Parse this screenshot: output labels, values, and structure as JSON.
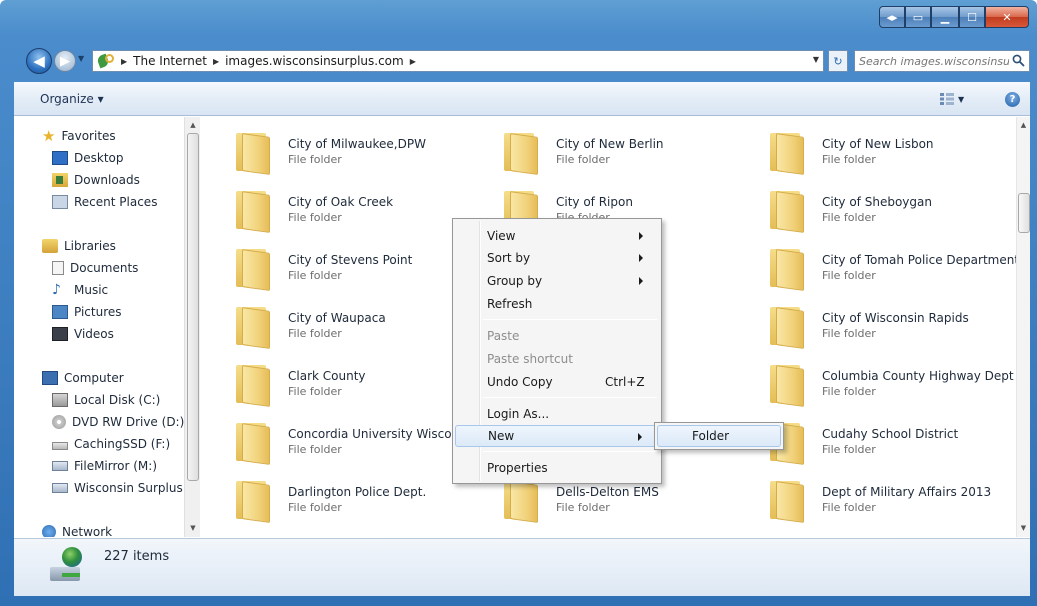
{
  "address": {
    "crumbs": [
      "The Internet",
      "images.wisconsinsurplus.com"
    ]
  },
  "search": {
    "placeholder": "Search images.wisconsinsur..."
  },
  "toolbar": {
    "organize_label": "Organize ▾"
  },
  "nav": {
    "favorites": {
      "label": "Favorites",
      "items": [
        "Desktop",
        "Downloads",
        "Recent Places"
      ]
    },
    "libraries": {
      "label": "Libraries",
      "items": [
        "Documents",
        "Music",
        "Pictures",
        "Videos"
      ]
    },
    "computer": {
      "label": "Computer",
      "items": [
        "Local Disk (C:)",
        "DVD RW Drive (D:)",
        "CachingSSD (F:)",
        "FileMirror (M:)",
        "Wisconsin Surplus"
      ]
    },
    "network": {
      "label": "Network"
    }
  },
  "folders": [
    {
      "name": "City of Milwaukee,DPW",
      "type": "File folder"
    },
    {
      "name": "City of New Berlin",
      "type": "File folder"
    },
    {
      "name": "City of New Lisbon",
      "type": "File folder"
    },
    {
      "name": "City of Oak Creek",
      "type": "File folder"
    },
    {
      "name": "City of Ripon",
      "type": "File folder"
    },
    {
      "name": "City of Sheboygan",
      "type": "File folder"
    },
    {
      "name": "City of Stevens Point",
      "type": "File folder"
    },
    {
      "name": "City of Tomah Police Department",
      "type": "File folder"
    },
    {
      "name": "City of Waupaca",
      "type": "File folder"
    },
    {
      "name": "City of Wisconsin Rapids",
      "type": "File folder"
    },
    {
      "name": "Clark County",
      "type": "File folder"
    },
    {
      "name": "Columbia County Highway Dept",
      "type": "File folder"
    },
    {
      "name": "Concordia University Wisconsin",
      "type": "File folder"
    },
    {
      "name": "Cudahy School District",
      "type": "File folder"
    },
    {
      "name": "Darlington Police Dept.",
      "type": "File folder"
    },
    {
      "name": "Dells-Delton EMS",
      "type": "File folder"
    },
    {
      "name": "Dept of Military Affairs 2013",
      "type": "File folder"
    }
  ],
  "status": {
    "item_count": "227 items"
  },
  "context_menu": {
    "view": "View",
    "sort_by": "Sort by",
    "group_by": "Group by",
    "refresh": "Refresh",
    "paste": "Paste",
    "paste_shortcut": "Paste shortcut",
    "undo_copy": "Undo Copy",
    "undo_shortcut": "Ctrl+Z",
    "login_as": "Login As...",
    "new": "New",
    "properties": "Properties"
  },
  "submenu": {
    "folder": "Folder"
  }
}
